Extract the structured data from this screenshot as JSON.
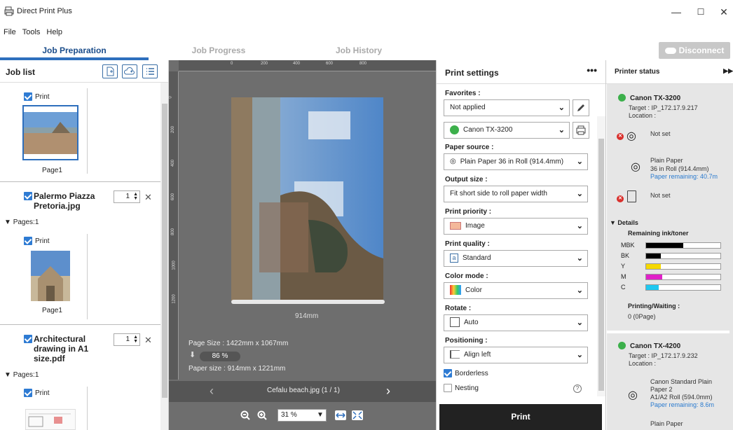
{
  "window": {
    "title": "Direct Print Plus",
    "min": "—",
    "max": "☐",
    "close": "✕"
  },
  "menu": [
    "File",
    "Tools",
    "Help"
  ],
  "tabs": {
    "job_preparation": "Job Preparation",
    "job_progress": "Job Progress",
    "job_history": "Job History",
    "disconnect": "Disconnect"
  },
  "job_list": {
    "title": "Job list",
    "print_label": "Print",
    "page1": "Page1",
    "job2": {
      "name_line1": "Palermo Piazza",
      "name_line2": "Pretoria.jpg",
      "qty": "1",
      "pages": "Pages:1"
    },
    "job3": {
      "name_line1": "Architectural",
      "name_line2": "drawing in A1",
      "name_line3": "size.pdf",
      "qty": "1",
      "pages": "Pages:1"
    }
  },
  "preview": {
    "ruler_top": [
      "0",
      "200",
      "400",
      "600",
      "800"
    ],
    "ruler_left": [
      "0",
      "200",
      "400",
      "600",
      "800",
      "1000",
      "1200"
    ],
    "width_label": "914mm",
    "page_size": "Page Size : 1422mm x 1067mm",
    "scale_pct": "86 %",
    "paper_size": "Paper size : 914mm x 1221mm",
    "file_label": "Cefalu beach.jpg (1 / 1)",
    "zoom": "31 %"
  },
  "settings": {
    "title": "Print settings",
    "more": "•••",
    "favorites_label": "Favorites  :",
    "favorites_value": "Not applied",
    "printer_value": "Canon TX-3200",
    "paper_source_label": "Paper source  :",
    "paper_source_value": "Plain Paper 36 in Roll (914.4mm)",
    "output_size_label": "Output size  :",
    "output_size_value": "Fit short side to roll paper width",
    "priority_label": "Print priority  :",
    "priority_value": "Image",
    "quality_label": "Print quality  :",
    "quality_value": "Standard",
    "color_label": "Color mode  :",
    "color_value": "Color",
    "rotate_label": "Rotate  :",
    "rotate_value": "Auto",
    "positioning_label": "Positioning  :",
    "positioning_value": "Align left",
    "borderless": "Borderless",
    "nesting": "Nesting",
    "help": "?",
    "print_button": "Print"
  },
  "printer_status": {
    "title": "Printer status",
    "p1": {
      "name": "Canon TX-3200",
      "target": "Target : IP_172.17.9.217",
      "location": "Location :",
      "not_set_1": "Not set",
      "paper_line1": "Plain Paper",
      "paper_line2": "36 in Roll (914.4mm)",
      "paper_remaining": "Paper remaining: 40.7m",
      "not_set_2": "Not set",
      "details": "Details",
      "ink_title": "Remaining ink/toner",
      "inks": [
        {
          "name": "MBK",
          "level": 0.5,
          "color": "#000000"
        },
        {
          "name": "BK",
          "level": 0.2,
          "color": "#000000"
        },
        {
          "name": "Y",
          "level": 0.2,
          "color": "#f5d800"
        },
        {
          "name": "M",
          "level": 0.22,
          "color": "#e020c8"
        },
        {
          "name": "C",
          "level": 0.17,
          "color": "#20c8f0"
        }
      ],
      "waiting_label": "Printing/Waiting :",
      "waiting_value": "0 (0Page)"
    },
    "p2": {
      "name": "Canon TX-4200",
      "target": "Target : IP_172.17.9.232",
      "location": "Location :",
      "paper_line1": "Canon Standard Plain",
      "paper_line2": "Paper 2",
      "paper_line3": "A1/A2 Roll (594.0mm)",
      "paper_remaining": "Paper remaining: 8.6m",
      "paper2_line1": "Plain Paper"
    }
  }
}
